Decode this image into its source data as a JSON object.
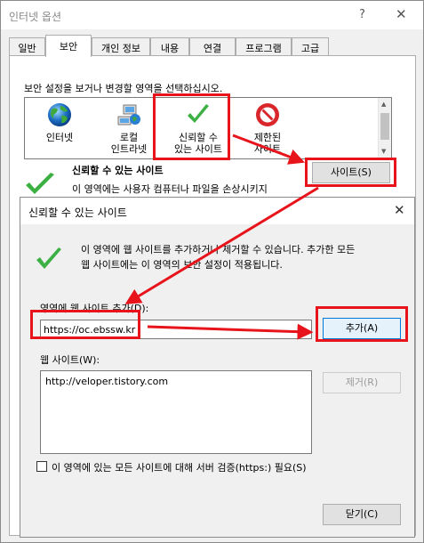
{
  "outer": {
    "title": "인터넷 옵션",
    "help_glyph": "?",
    "close_glyph": "✕",
    "tabs": [
      {
        "label": "일반"
      },
      {
        "label": "보안"
      },
      {
        "label": "개인 정보"
      },
      {
        "label": "내용"
      },
      {
        "label": "연결"
      },
      {
        "label": "프로그램"
      },
      {
        "label": "고급"
      }
    ],
    "active_tab": "보안",
    "instruction": "보안 설정을 보거나 변경할 영역을 선택하십시오.",
    "zones": [
      {
        "label": "인터넷",
        "icon": "globe-icon"
      },
      {
        "label": "로컬\n인트라넷",
        "icon": "intranet-icon"
      },
      {
        "label": "신뢰할 수\n있는 사이트",
        "icon": "check-icon"
      },
      {
        "label": "제한된\n사이트",
        "icon": "restricted-icon"
      }
    ],
    "zone_heading": "신뢰할 수 있는 사이트",
    "zone_description": "이 영역에는 사용자 컴퓨터나 파일을 손상시키지",
    "sites_button": "사이트(S)"
  },
  "inner": {
    "title": "신뢰할 수 있는 사이트",
    "close_glyph": "✕",
    "info": "이 영역에 웹 사이트를 추가하거나 제거할 수 있습니다. 추가한 모든\n웹 사이트에는 이 영역의 보안 설정이 적용됩니다.",
    "add_label": "영역에 웹 사이트 추가(D):",
    "add_value": "https://oc.ebssw.kr",
    "add_button": "추가(A)",
    "sites_label": "웹 사이트(W):",
    "sites": [
      "http://veloper.tistory.com"
    ],
    "remove_button": "제거(R)",
    "https_label": "이 영역에 있는 모든 사이트에 대해 서버 검증(https:) 필요(S)",
    "https_checked": false,
    "close_button": "닫기(C)"
  },
  "colors": {
    "annotation": "#e8141b",
    "check_green": "#3cb043",
    "restricted_red": "#d8262b",
    "accent_blue": "#0078d7"
  }
}
